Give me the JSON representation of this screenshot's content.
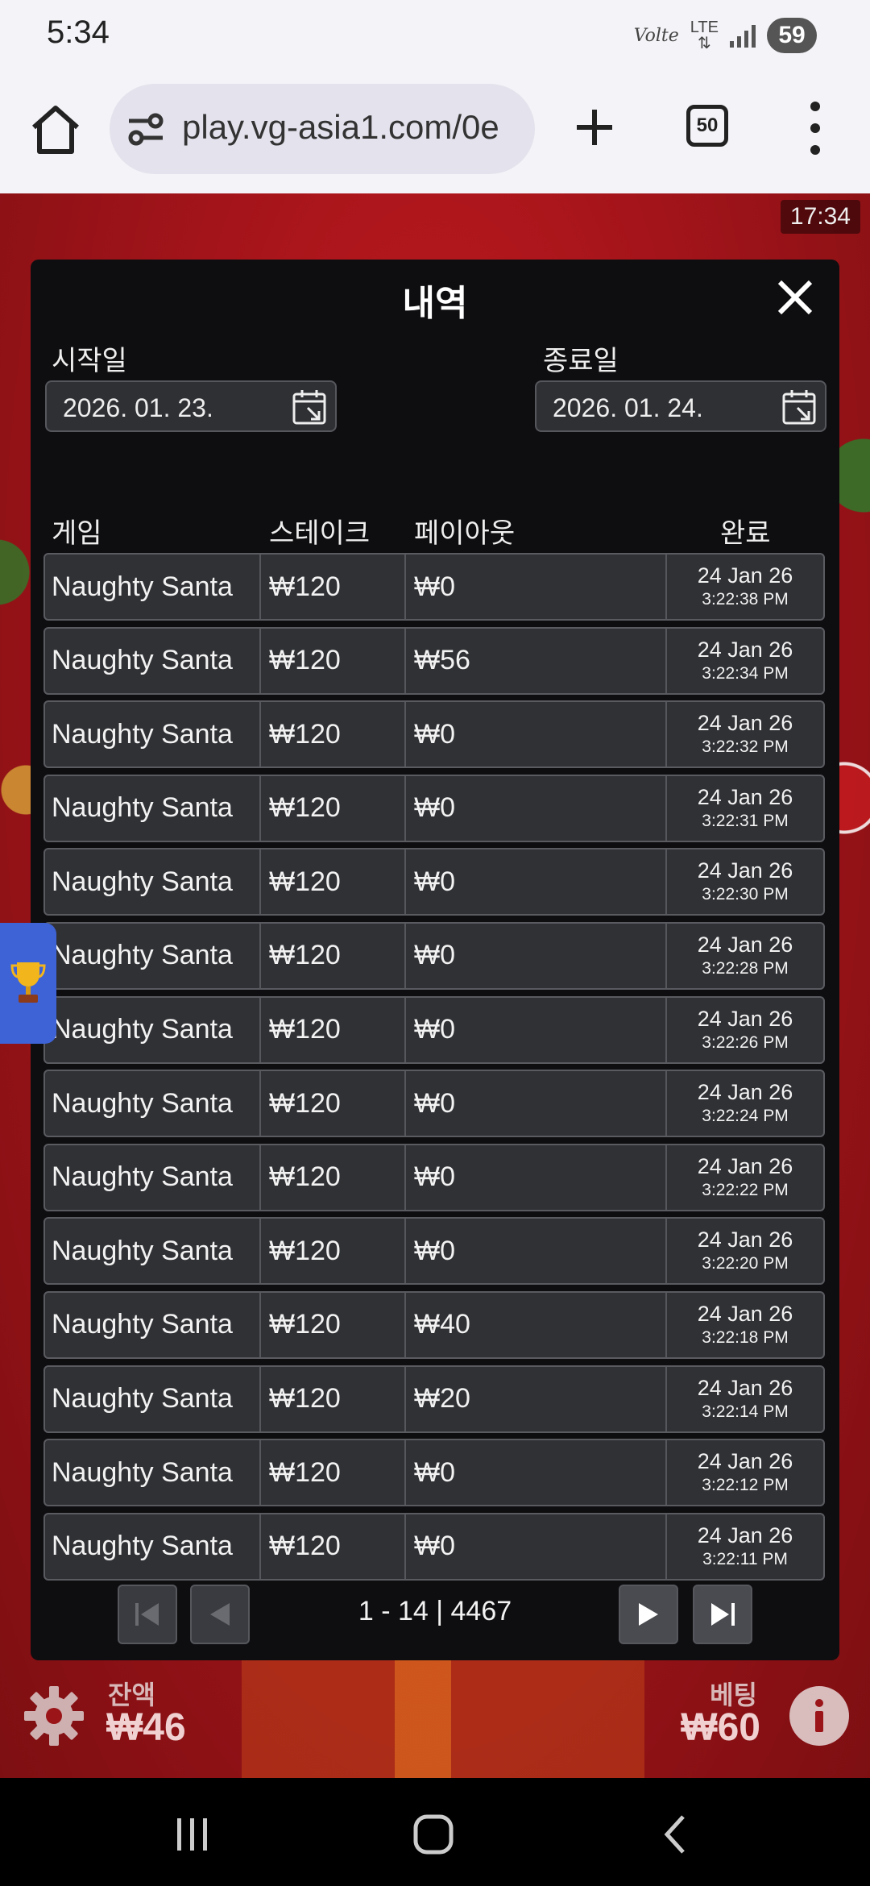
{
  "status_bar": {
    "time": "5:34",
    "volte": "Volte",
    "network": "LTE",
    "battery": "59"
  },
  "browser": {
    "url": "play.vg-asia1.com/0e",
    "tab_count": "50"
  },
  "game": {
    "clock": "17:34",
    "balance_label": "잔액",
    "balance_value": "₩46",
    "bet_label": "베팅",
    "bet_value": "₩60"
  },
  "modal": {
    "title": "내역",
    "start_label": "시작일",
    "start_date": "2026. 01. 23.",
    "end_label": "종료일",
    "end_date": "2026. 01. 24.",
    "columns": {
      "game": "게임",
      "stake": "스테이크",
      "payout": "페이아웃",
      "done": "완료"
    },
    "rows": [
      {
        "game": "Naughty Santa",
        "stake": "₩120",
        "payout": "₩0",
        "date": "24 Jan 26",
        "time": "3:22:38 PM"
      },
      {
        "game": "Naughty Santa",
        "stake": "₩120",
        "payout": "₩56",
        "date": "24 Jan 26",
        "time": "3:22:34 PM"
      },
      {
        "game": "Naughty Santa",
        "stake": "₩120",
        "payout": "₩0",
        "date": "24 Jan 26",
        "time": "3:22:32 PM"
      },
      {
        "game": "Naughty Santa",
        "stake": "₩120",
        "payout": "₩0",
        "date": "24 Jan 26",
        "time": "3:22:31 PM"
      },
      {
        "game": "Naughty Santa",
        "stake": "₩120",
        "payout": "₩0",
        "date": "24 Jan 26",
        "time": "3:22:30 PM"
      },
      {
        "game": "Naughty Santa",
        "stake": "₩120",
        "payout": "₩0",
        "date": "24 Jan 26",
        "time": "3:22:28 PM"
      },
      {
        "game": "Naughty Santa",
        "stake": "₩120",
        "payout": "₩0",
        "date": "24 Jan 26",
        "time": "3:22:26 PM"
      },
      {
        "game": "Naughty Santa",
        "stake": "₩120",
        "payout": "₩0",
        "date": "24 Jan 26",
        "time": "3:22:24 PM"
      },
      {
        "game": "Naughty Santa",
        "stake": "₩120",
        "payout": "₩0",
        "date": "24 Jan 26",
        "time": "3:22:22 PM"
      },
      {
        "game": "Naughty Santa",
        "stake": "₩120",
        "payout": "₩0",
        "date": "24 Jan 26",
        "time": "3:22:20 PM"
      },
      {
        "game": "Naughty Santa",
        "stake": "₩120",
        "payout": "₩40",
        "date": "24 Jan 26",
        "time": "3:22:18 PM"
      },
      {
        "game": "Naughty Santa",
        "stake": "₩120",
        "payout": "₩20",
        "date": "24 Jan 26",
        "time": "3:22:14 PM"
      },
      {
        "game": "Naughty Santa",
        "stake": "₩120",
        "payout": "₩0",
        "date": "24 Jan 26",
        "time": "3:22:12 PM"
      },
      {
        "game": "Naughty Santa",
        "stake": "₩120",
        "payout": "₩0",
        "date": "24 Jan 26",
        "time": "3:22:11 PM"
      }
    ],
    "pagination": "1 - 14 | 4467"
  }
}
